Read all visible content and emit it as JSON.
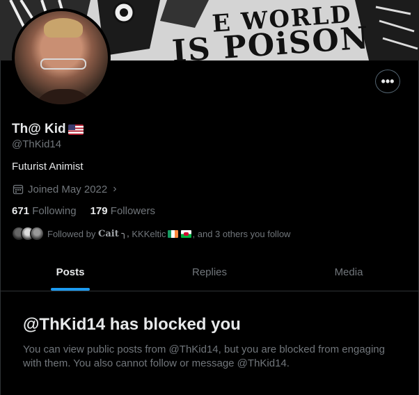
{
  "banner": {
    "line1": "E WORLD",
    "line2": "IS POiSON"
  },
  "profile": {
    "display_name": "Th@ Kid",
    "handle": "@ThKid14",
    "bio": "Futurist Animist",
    "joined": "Joined May 2022",
    "following_count": "671",
    "following_label": "Following",
    "followers_count": "179",
    "followers_label": "Followers",
    "followed_by_prefix": "Followed by",
    "followed_by_name1": "Cait",
    "followed_by_name2": "KKKeltic",
    "followed_by_suffix": ", and 3 others you follow"
  },
  "tabs": [
    {
      "label": "Posts",
      "active": true
    },
    {
      "label": "Replies",
      "active": false
    },
    {
      "label": "Media",
      "active": false
    }
  ],
  "blocked": {
    "title": "@ThKid14 has blocked you",
    "text": "You can view public posts from @ThKid14, but you are blocked from engaging with them. You also cannot follow or message @ThKid14."
  },
  "colors": {
    "accent": "#1d9bf0",
    "muted": "#71767b",
    "text": "#e7e9ea",
    "border": "#2f3336"
  }
}
